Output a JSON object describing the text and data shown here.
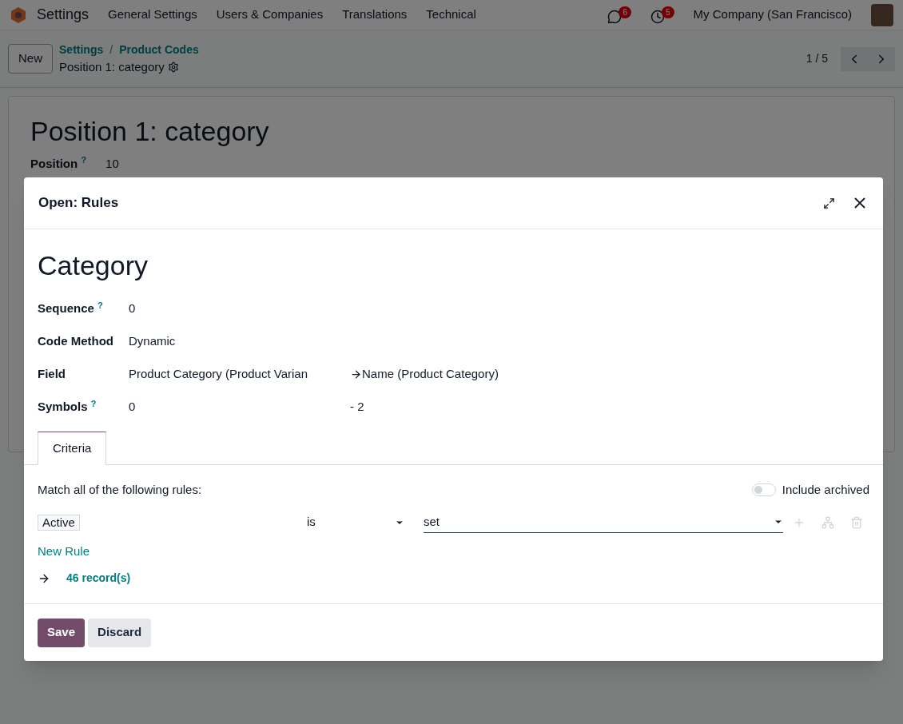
{
  "navbar": {
    "app": "Settings",
    "menus": [
      "General Settings",
      "Users & Companies",
      "Translations",
      "Technical"
    ],
    "messages_badge": "6",
    "activities_badge": "5",
    "company": "My Company (San Francisco)"
  },
  "control_panel": {
    "new_button": "New",
    "breadcrumbs": [
      "Settings",
      "Product Codes"
    ],
    "separator": "/",
    "record": "Position 1: category",
    "pager": "1 / 5"
  },
  "form": {
    "title": "Position 1: category",
    "fields": [
      {
        "label": "Position",
        "help": "?",
        "value": "10"
      }
    ]
  },
  "dialog": {
    "title": "Open: Rules",
    "heading": "Category",
    "fields": [
      {
        "label": "Sequence",
        "help": "?",
        "values": [
          "0"
        ]
      },
      {
        "label": "Code Method",
        "values": [
          "Dynamic"
        ]
      },
      {
        "label": "Field",
        "values": [
          "Product Category (Product Varian",
          "Name (Product Category)"
        ]
      },
      {
        "label": "Symbols",
        "help": "?",
        "values": [
          "0",
          "- 2"
        ]
      }
    ],
    "tabs": [
      {
        "label": "Criteria",
        "selected": true
      }
    ],
    "criteria": {
      "intro": "Match all of the following rules:",
      "include_archived": {
        "label": "Include archived",
        "on": false
      },
      "rules": [
        {
          "field": "Active",
          "operator": "is",
          "value": "set"
        }
      ],
      "new_rule": "New Rule",
      "records": "46 record(s)"
    },
    "buttons": [
      {
        "label": "Save",
        "kind": "primary"
      },
      {
        "label": "Discard",
        "kind": "secondary"
      }
    ]
  }
}
